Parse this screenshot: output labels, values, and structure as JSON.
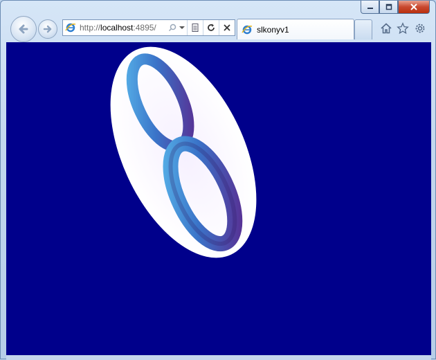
{
  "window": {
    "minimize_icon": "minimize-icon",
    "maximize_icon": "restore-icon",
    "close_icon": "close-icon"
  },
  "nav": {
    "back_icon": "back-arrow-icon",
    "forward_icon": "forward-arrow-icon"
  },
  "address_bar": {
    "url_prefix": "http://",
    "url_host": "localhost",
    "url_rest": ":4895/"
  },
  "tab": {
    "title": "slkonyv1"
  },
  "toolbar": {
    "home_icon": "home-icon",
    "favorites_icon": "star-icon",
    "tools_icon": "gear-icon"
  },
  "content": {
    "background_color": "#00008b",
    "ellipse_color": "#ffffff",
    "logo_gradient": [
      "#4aa3e0",
      "#3a6fc6",
      "#5b2a8f"
    ]
  }
}
